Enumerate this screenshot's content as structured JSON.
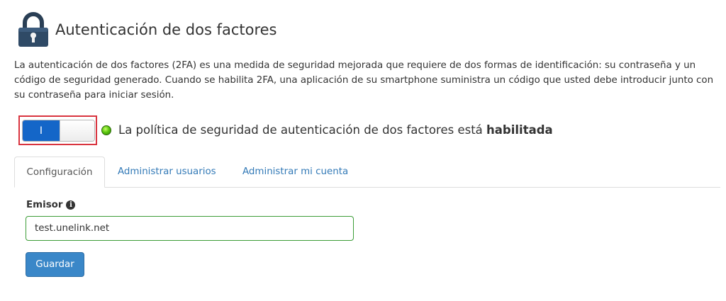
{
  "header": {
    "title": "Autenticación de dos factores",
    "icon": "lock-icon"
  },
  "description": "La autenticación de dos factores (2FA) es una medida de seguridad mejorada que requiere de dos formas de identificación: su contraseña y un código de seguridad generado. Cuando se habilita 2FA, una aplicación de su smartphone suministra un código que usted debe introducir junto con su contraseña para iniciar sesión.",
  "policy": {
    "toggle_label": "I",
    "toggle_state": "on",
    "status_prefix": "La política de seguridad de autenticación de dos factores está ",
    "status_value": "habilitada",
    "led_color": "#5cc80e",
    "highlight_color": "#d9343f"
  },
  "tabs": [
    {
      "label": "Configuración",
      "active": true
    },
    {
      "label": "Administrar usuarios",
      "active": false
    },
    {
      "label": "Administrar mi cuenta",
      "active": false
    }
  ],
  "form": {
    "issuer_label": "Emisor",
    "issuer_info_icon": "info-icon",
    "issuer_value": "test.unelink.net",
    "save_label": "Guardar"
  },
  "colors": {
    "accent": "#1466c8",
    "link": "#337ab7",
    "button": "#3a87c8",
    "input_border": "#3c9d37"
  }
}
